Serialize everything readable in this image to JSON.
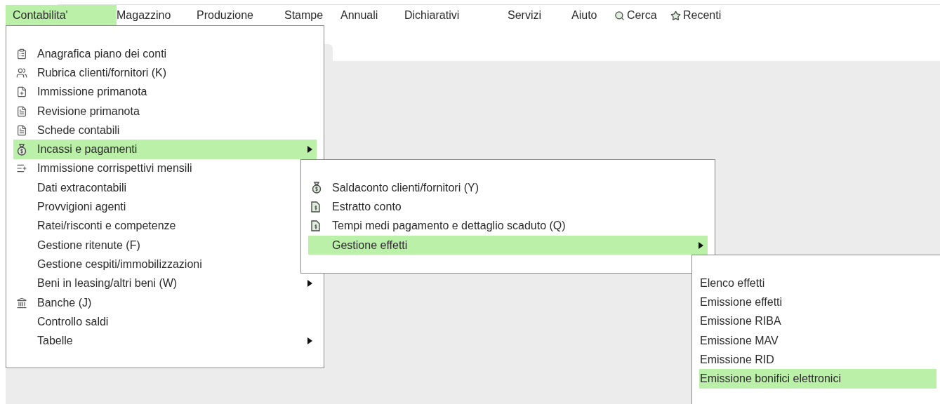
{
  "menu_bar": [
    {
      "label": "Contabilita'",
      "selected": true
    },
    {
      "label": "Magazzino",
      "selected": false
    },
    {
      "label": "Produzione",
      "selected": false
    },
    {
      "label": "Stampe",
      "selected": false
    },
    {
      "label": "Annuali",
      "selected": false
    },
    {
      "label": "Dichiarativi",
      "selected": false
    },
    {
      "label": "Servizi",
      "selected": false
    },
    {
      "label": "Aiuto",
      "selected": false
    },
    {
      "label": "Cerca",
      "selected": false
    },
    {
      "label": "Recenti",
      "selected": false
    }
  ],
  "menus": [
    {
      "items": [
        {
          "label": "Anagrafica piano dei conti",
          "selected": false,
          "submenu": false
        },
        {
          "label": "Rubrica clienti/fornitori (K)",
          "selected": false,
          "submenu": false
        },
        {
          "label": "Immissione primanota",
          "selected": false,
          "submenu": false
        },
        {
          "label": "Revisione primanota",
          "selected": false,
          "submenu": false
        },
        {
          "label": "Schede contabili",
          "selected": false,
          "submenu": false
        },
        {
          "label": "Incassi e pagamenti",
          "selected": true,
          "submenu": true
        },
        {
          "label": "Immissione corrispettivi mensili",
          "selected": false
        },
        {
          "label": "Dati extracontabili",
          "selected": false
        },
        {
          "label": "Provvigioni agenti",
          "selected": false
        },
        {
          "label": "Ratei/risconti e competenze",
          "selected": false
        },
        {
          "label": "Gestione ritenute (F)",
          "selected": false
        },
        {
          "label": "Gestione cespiti/immobilizzazioni",
          "selected": false
        },
        {
          "label": "Beni in leasing/altri beni (W)",
          "selected": false,
          "submenu": true
        },
        {
          "label": "Banche (J)",
          "selected": false,
          "submenu": false
        },
        {
          "label": "Controllo saldi",
          "selected": false,
          "submenu": false
        },
        {
          "label": "Tabelle",
          "selected": false,
          "submenu": true
        }
      ]
    },
    {
      "items": [
        {
          "label": "Saldaconto clienti/fornitori (Y)",
          "selected": false,
          "submenu": false
        },
        {
          "label": "Estratto conto",
          "selected": false,
          "submenu": false
        },
        {
          "label": "Tempi medi pagamento e dettaglio scaduto (Q)",
          "selected": false,
          "submenu": false
        },
        {
          "label": "Gestione effetti",
          "selected": true,
          "submenu": true
        }
      ]
    },
    {
      "items": [
        {
          "label": "Elenco effetti",
          "selected": false,
          "submenu": false
        },
        {
          "label": "Emissione effetti",
          "selected": false,
          "submenu": false
        },
        {
          "label": "Emissione RIBA",
          "selected": false,
          "submenu": false
        },
        {
          "label": "Emissione MAV",
          "selected": false,
          "submenu": false
        },
        {
          "label": "Emissione RID",
          "selected": false,
          "submenu": false
        },
        {
          "label": "Emissione bonifici elettronici",
          "selected": true,
          "submenu": false
        }
      ]
    }
  ]
}
